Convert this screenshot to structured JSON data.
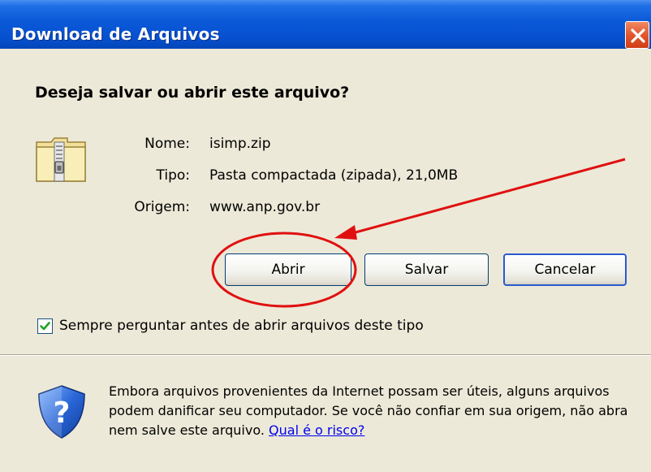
{
  "window": {
    "title": "Download de Arquivos",
    "close_icon": "close-icon"
  },
  "dialog": {
    "question": "Deseja salvar ou abrir este arquivo?",
    "file_icon": "zip-folder-icon",
    "fields": [
      {
        "label": "Nome:",
        "value": "isimp.zip"
      },
      {
        "label": "Tipo:",
        "value": "Pasta compactada (zipada), 21,0MB"
      },
      {
        "label": "Origem:",
        "value": "www.anp.gov.br"
      }
    ],
    "buttons": {
      "open": "Abrir",
      "save": "Salvar",
      "cancel": "Cancelar"
    },
    "checkbox": {
      "label": "Sempre perguntar antes de abrir arquivos deste tipo",
      "checked": true
    },
    "warning": {
      "icon": "shield-question-icon",
      "text": "Embora arquivos provenientes da Internet possam ser úteis, alguns arquivos podem danificar seu computador. Se você não confiar em sua origem, não abra nem salve este arquivo.",
      "link": "Qual é o risco?"
    }
  },
  "annotation": {
    "color": "#e01010",
    "target": "open-button"
  },
  "colors": {
    "titlebar": "#0a58d8",
    "dialog_bg": "#ece9d8",
    "close_button": "#e2562d",
    "link": "#0000ee"
  }
}
